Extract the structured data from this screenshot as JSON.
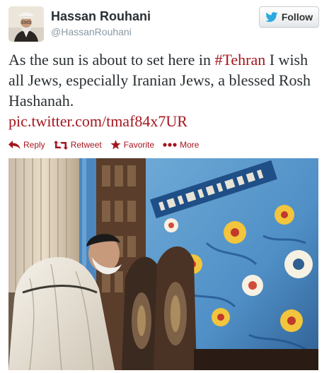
{
  "user": {
    "name": "Hassan Rouhani",
    "handle": "@HassanRouhani",
    "avatar_icon": "portrait-avatar"
  },
  "follow": {
    "label": "Follow",
    "icon": "bird-icon",
    "icon_color": "#2aa9e0"
  },
  "tweet": {
    "text_part1": "As the sun is about to set here in ",
    "hashtag": "#Tehran",
    "text_part2": " I wish all Jews, especially Iranian Jews, a blessed Rosh Hashanah.",
    "link": "pic.twitter.com/tmaf84x7UR"
  },
  "actions": {
    "reply": "Reply",
    "retweet": "Retweet",
    "favorite": "Favorite",
    "more": "More"
  },
  "colors": {
    "link": "#a4161f",
    "text": "#292f33",
    "muted": "#8899a6"
  }
}
